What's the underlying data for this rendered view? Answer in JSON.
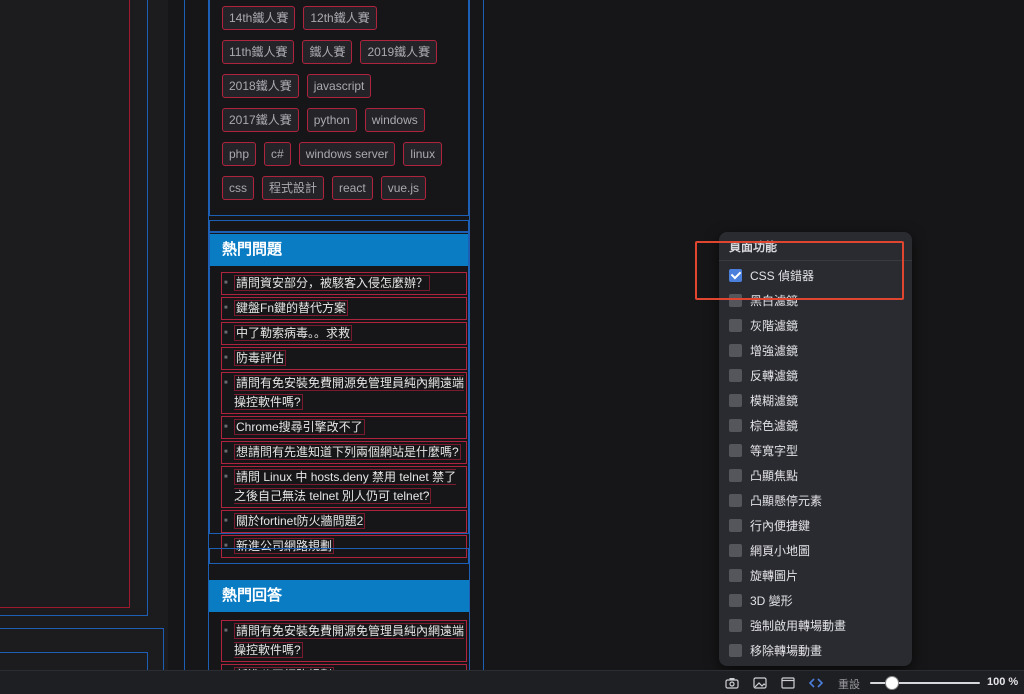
{
  "tags": [
    [
      "14th鐵人賽",
      "12th鐵人賽"
    ],
    [
      "11th鐵人賽",
      "鐵人賽",
      "2019鐵人賽"
    ],
    [
      "2018鐵人賽",
      "javascript"
    ],
    [
      "2017鐵人賽",
      "python",
      "windows"
    ],
    [
      "php",
      "c#",
      "windows server",
      "linux"
    ],
    [
      "css",
      "程式設計",
      "react",
      "vue.js"
    ]
  ],
  "hot_questions": {
    "title": "熱門問題",
    "items": [
      "請問資安部分，被駭客入侵怎麼辦？",
      "鍵盤Fn鍵的替代方案",
      "中了勒索病毒。。求救",
      "防毒評估",
      "請問有免安裝免費開源免管理員純內網遠端操控軟件嗎?",
      "Chrome搜尋引擎改不了",
      "想請問有先進知道下列兩個網站是什麼嗎?",
      "請問 Linux 中 hosts.deny 禁用 telnet 禁了之後自己無法 telnet 別人仍可 telnet?",
      "關於fortinet防火牆問題2",
      "新進公司網路規劃"
    ]
  },
  "hot_answers": {
    "title": "熱門回答",
    "items": [
      "請問有免安裝免費開源免管理員純內網遠端操控軟件嗎?",
      "新進公司網路規劃"
    ]
  },
  "panel": {
    "title": "頁面功能",
    "options": [
      {
        "label": "CSS 偵錯器",
        "checked": true
      },
      {
        "label": "黑白濾鏡",
        "checked": false
      },
      {
        "label": "灰階濾鏡",
        "checked": false
      },
      {
        "label": "增強濾鏡",
        "checked": false
      },
      {
        "label": "反轉濾鏡",
        "checked": false
      },
      {
        "label": "模糊濾鏡",
        "checked": false
      },
      {
        "label": "棕色濾鏡",
        "checked": false
      },
      {
        "label": "等寬字型",
        "checked": false
      },
      {
        "label": "凸顯焦點",
        "checked": false
      },
      {
        "label": "凸顯懸停元素",
        "checked": false
      },
      {
        "label": "行內便捷鍵",
        "checked": false
      },
      {
        "label": "網頁小地圖",
        "checked": false
      },
      {
        "label": "旋轉圖片",
        "checked": false
      },
      {
        "label": "3D 變形",
        "checked": false
      },
      {
        "label": "強制啟用轉場動畫",
        "checked": false
      },
      {
        "label": "移除轉場動畫",
        "checked": false
      }
    ]
  },
  "bottom_bar": {
    "icons": [
      "camera-icon",
      "image-icon",
      "window-icon",
      "code-icon"
    ],
    "reset_label": "重設",
    "zoom_label": "100 %",
    "zoom_fraction": 0.2
  }
}
